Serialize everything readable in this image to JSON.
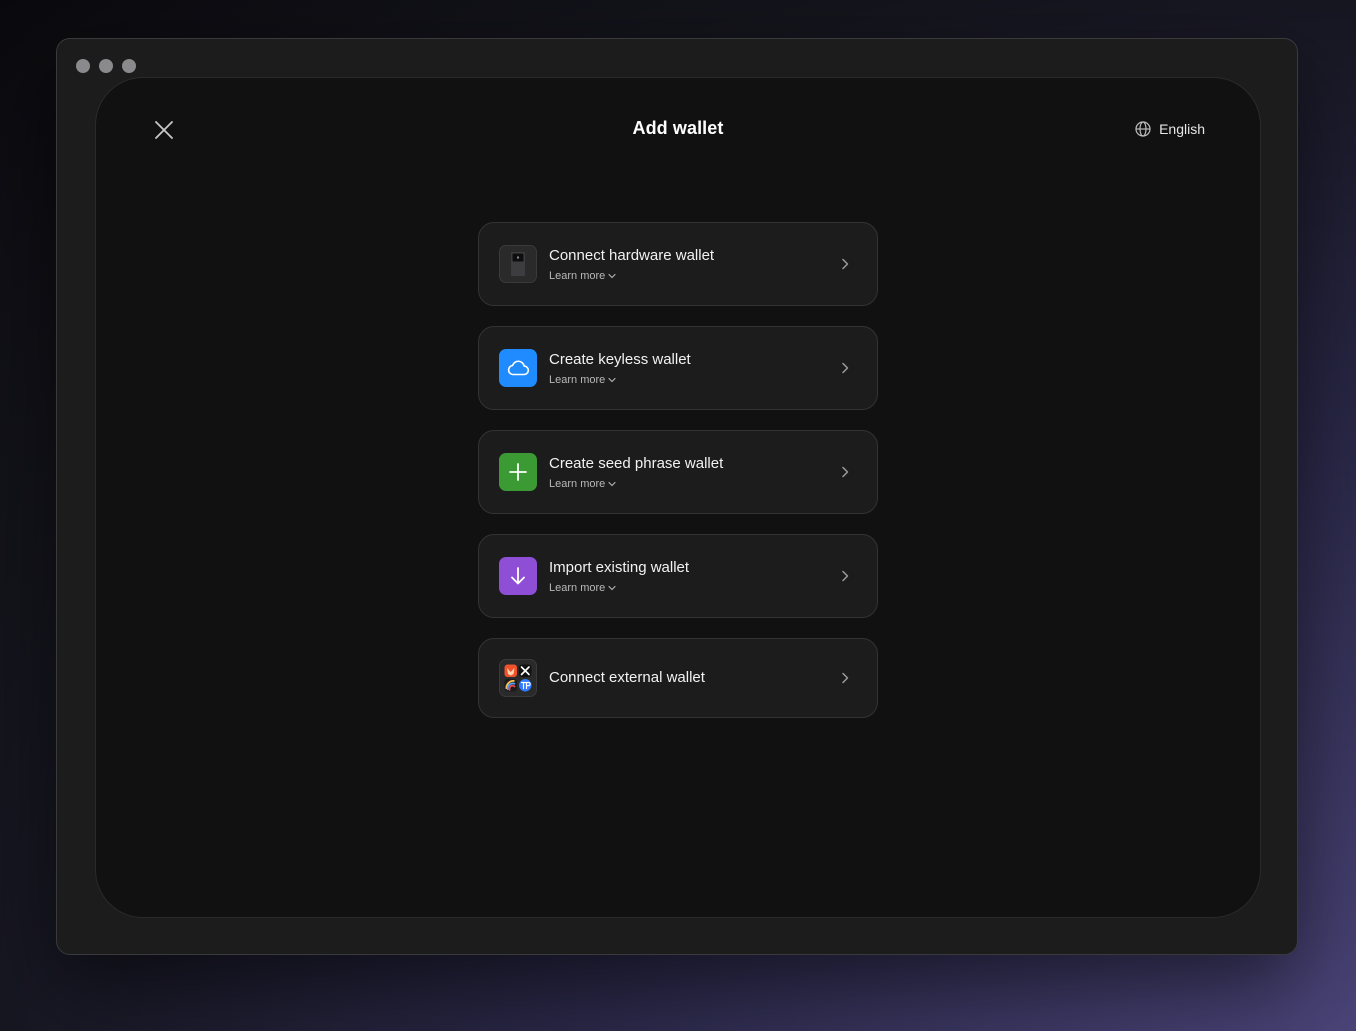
{
  "header": {
    "title": "Add wallet",
    "close_icon": "close-icon",
    "language": "English",
    "language_icon": "globe-icon"
  },
  "options": [
    {
      "title": "Connect hardware wallet",
      "subtitle": "Learn more",
      "icon": "hardware-wallet-icon",
      "icon_bg": "#2a2a2b"
    },
    {
      "title": "Create keyless wallet",
      "subtitle": "Learn more",
      "icon": "cloud-icon",
      "icon_bg": "#1f8bff"
    },
    {
      "title": "Create seed phrase wallet",
      "subtitle": "Learn more",
      "icon": "plus-icon",
      "icon_bg": "#3c9a34"
    },
    {
      "title": "Import existing wallet",
      "subtitle": "Learn more",
      "icon": "arrow-down-icon",
      "icon_bg": "#8e4fd6"
    },
    {
      "title": "Connect external wallet",
      "icon": "external-wallets-icon",
      "icon_bg": "#2a2a2b"
    }
  ]
}
